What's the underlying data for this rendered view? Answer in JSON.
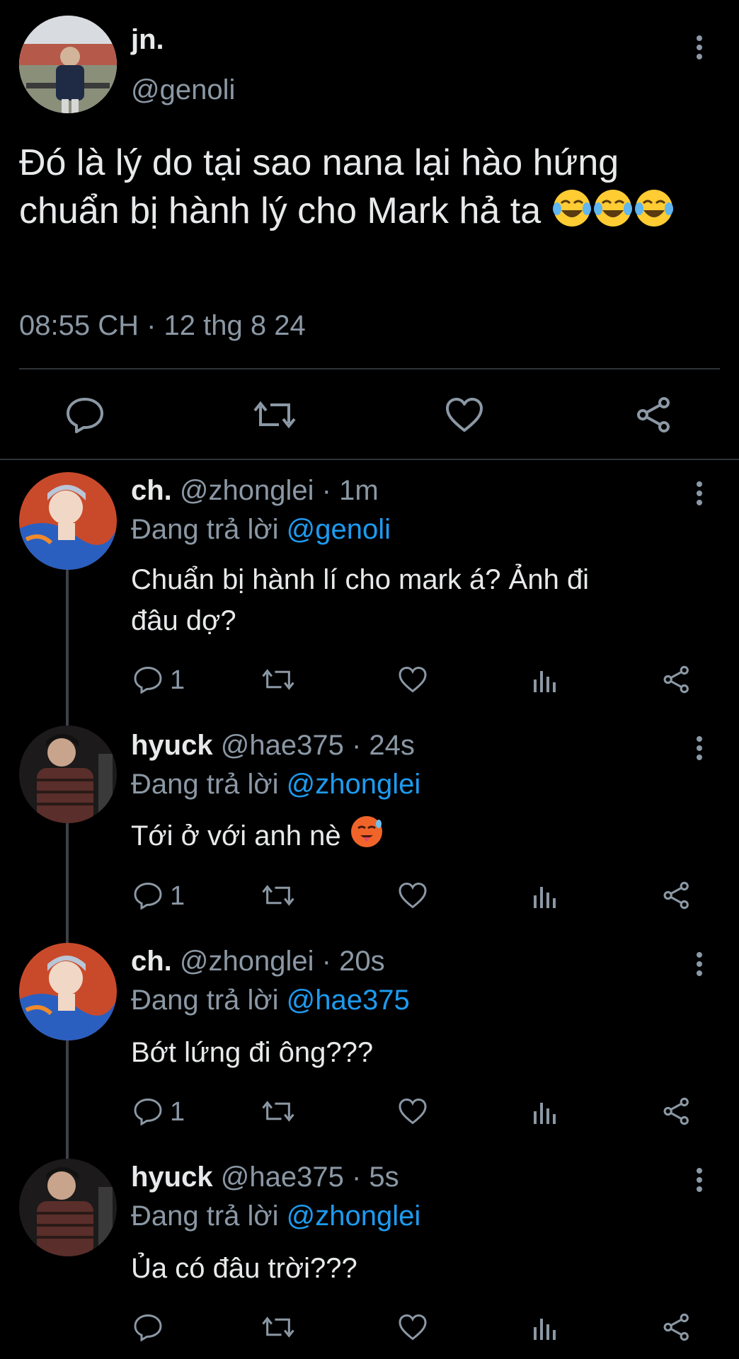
{
  "main_tweet": {
    "display_name": "jn.",
    "handle": "@genoli",
    "text": "Đó là lý do tại sao nana lại hào hứng chuẩn bị hành lý cho Mark hả ta",
    "timestamp": "08:55 CH · 12 thg 8 24"
  },
  "replies": [
    {
      "display_name": "ch.",
      "handle": "@zhonglei",
      "time": "· 1m",
      "replying_prefix": "Đang trả lời",
      "replying_to": "@genoli",
      "text_line1": "Chuẩn bị hành lí cho mark á? Ảnh đi",
      "text_line2": "đâu dợ?",
      "reply_count": "1"
    },
    {
      "display_name": "hyuck",
      "handle": "@hae375",
      "time": "· 24s",
      "replying_prefix": "Đang trả lời",
      "replying_to": "@zhonglei",
      "text_line1": "Tới ở với anh nè",
      "reply_count": "1"
    },
    {
      "display_name": "ch.",
      "handle": "@zhonglei",
      "time": "· 20s",
      "replying_prefix": "Đang trả lời",
      "replying_to": "@hae375",
      "text_line1": "Bớt lứng đi ông???",
      "reply_count": "1"
    },
    {
      "display_name": "hyuck",
      "handle": "@hae375",
      "time": "· 5s",
      "replying_prefix": "Đang trả lời",
      "replying_to": "@zhonglei",
      "text_line1": "Ủa có đâu trời???",
      "reply_count": ""
    }
  ],
  "colors": {
    "accent": "#1d9bf0",
    "muted": "#8b98a5",
    "text": "#e7e9ea",
    "bg": "#000000"
  }
}
